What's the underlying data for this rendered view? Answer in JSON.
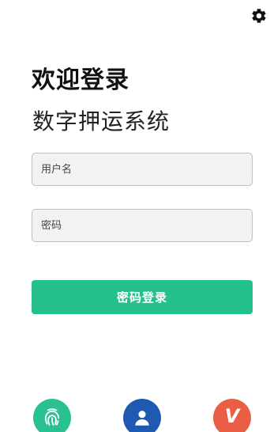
{
  "header": {
    "welcome": "欢迎登录",
    "subtitle": "数字押运系统",
    "settings_icon": "gear-icon"
  },
  "form": {
    "username_placeholder": "用户名",
    "password_placeholder": "密码",
    "login_label": "密码登录"
  },
  "alt_login": {
    "fingerprint_icon": "fingerprint-icon",
    "user_icon": "user-icon",
    "v_label": "V"
  },
  "colors": {
    "primary_green": "#25c08e",
    "fingerprint_bg": "#2ac192",
    "user_bg": "#1e5ab2",
    "v_bg": "#ea5e46"
  }
}
